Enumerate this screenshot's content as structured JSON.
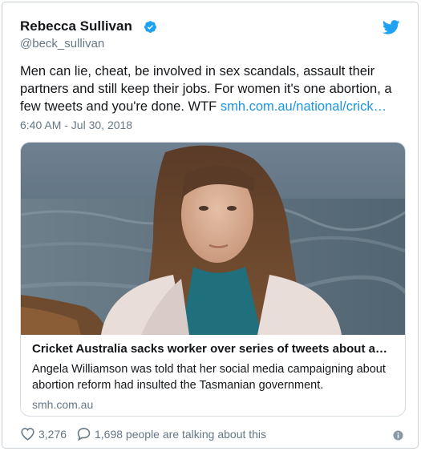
{
  "tweet": {
    "display_name": "Rebecca Sullivan",
    "handle": "@beck_sullivan",
    "text_main": "Men can lie, cheat, be involved in sex scandals, assault their partners and still keep their jobs. For women it's one abortion, a few tweets and you're done. WTF ",
    "text_link": "smh.com.au/national/crick…",
    "timestamp": "6:40 AM - Jul 30, 2018"
  },
  "card": {
    "title": "Cricket Australia sacks worker over series of tweets about ab…",
    "description": "Angela Williamson was told that her social media campaigning about abortion reform had insulted the Tasmanian government.",
    "domain": "smh.com.au"
  },
  "footer": {
    "likes": "3,276",
    "talking": "1,698 people are talking about this"
  },
  "colors": {
    "link": "#1b95e0",
    "secondary": "#657786",
    "verified": "#1da1f2"
  },
  "icons": [
    "verified-badge-icon",
    "twitter-bird-icon",
    "heart-icon",
    "speech-bubble-icon",
    "info-icon"
  ]
}
